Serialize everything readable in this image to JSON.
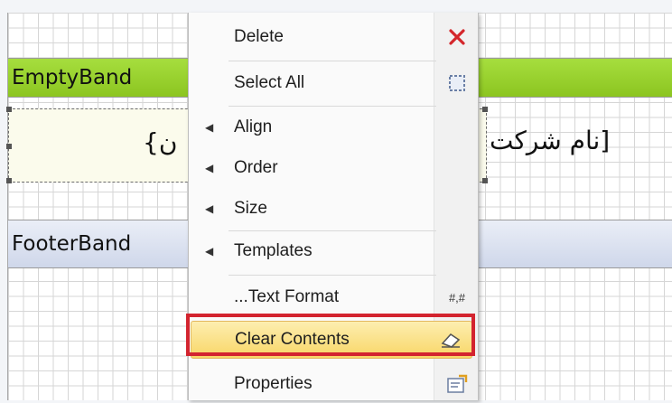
{
  "designer": {
    "empty_band_title": "EmptyBand",
    "footer_band_title": "FooterBand",
    "textbox_left_fragment": "{ن",
    "textbox_right_fragment": "نام شرکت]"
  },
  "context_menu": {
    "items": [
      {
        "label": "Delete",
        "icon": "delete-x-icon"
      },
      {
        "label": "Select All",
        "icon": "select-all-icon"
      },
      {
        "label": "Align",
        "submenu": true
      },
      {
        "label": "Order",
        "submenu": true
      },
      {
        "label": "Size",
        "submenu": true
      },
      {
        "label": "Templates",
        "submenu": true
      },
      {
        "label": "...Text Format",
        "icon": "text-format-icon",
        "icon_text": "#,#"
      },
      {
        "label": "Clear Contents",
        "icon": "eraser-icon",
        "highlighted": true
      },
      {
        "label": "Properties",
        "icon": "properties-icon"
      }
    ]
  },
  "colors": {
    "empty_band": "#9ad22e",
    "footer_band": "#d6ddee",
    "highlight": "#f8d666",
    "callout_border": "#d3242f",
    "delete_icon": "#d4262b"
  }
}
